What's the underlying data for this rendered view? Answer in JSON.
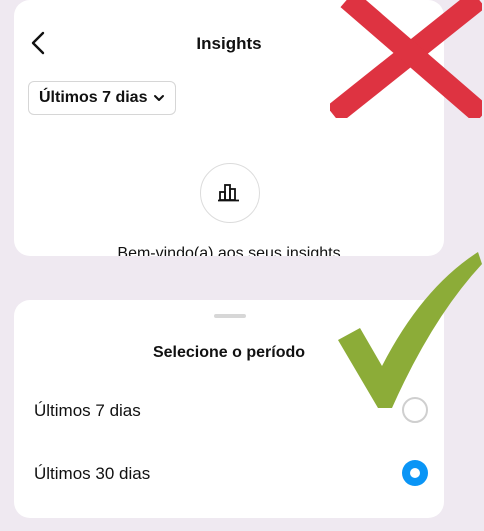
{
  "header": {
    "title": "Insights",
    "back_icon": "chevron-left-icon",
    "period_chip": "Últimos 7 dias",
    "chip_icon": "chevron-down-icon"
  },
  "insights_empty": {
    "icon": "bar-chart-icon",
    "welcome_text": "Bem-vindo(a) aos seus insights"
  },
  "period_sheet": {
    "title": "Selecione o período",
    "options": [
      {
        "label": "Últimos 7 dias",
        "selected": false
      },
      {
        "label": "Últimos 30 dias",
        "selected": true
      }
    ]
  },
  "overlays": {
    "wrong_mark": {
      "icon": "red-x-mark",
      "color": "#de3341"
    },
    "correct_mark": {
      "icon": "green-check-mark",
      "color": "#8cac38"
    }
  },
  "colors": {
    "background": "#efe9f1",
    "accent_blue": "#0a95f6"
  }
}
